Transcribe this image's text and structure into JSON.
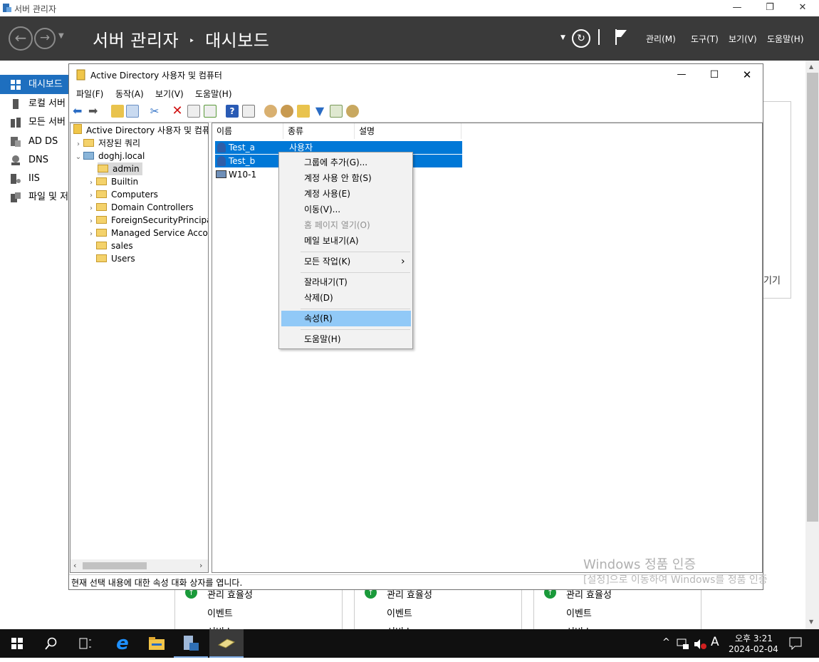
{
  "sm": {
    "app_title": "서버 관리자",
    "breadcrumb_root": "서버 관리자",
    "breadcrumb_sep": "‣",
    "breadcrumb_page": "대시보드",
    "menus": [
      "관리(M)",
      "도구(T)",
      "보기(V)",
      "도움말(H)"
    ],
    "nav": [
      "대시보드",
      "로컬 서버",
      "모든 서버",
      "AD DS",
      "DNS",
      "IIS",
      "파일 및 저장소"
    ],
    "right_text": "기기",
    "tiles": [
      {
        "line1": "관리 효율성",
        "line2": "이벤트",
        "line3": "서비스"
      },
      {
        "line1": "관리 효율성",
        "line2": "이벤트",
        "line3": "서비스"
      },
      {
        "line1": "관리 효율성",
        "line2": "이벤트",
        "line3": "서비스"
      }
    ]
  },
  "aduc": {
    "title": "Active Directory 사용자 및 컴퓨터",
    "menu": [
      "파일(F)",
      "동작(A)",
      "보기(V)",
      "도움말(H)"
    ],
    "tree": {
      "root": "Active Directory 사용자 및 컴퓨터",
      "saved": "저장된 쿼리",
      "domain": "doghj.local",
      "children": [
        "admin",
        "Builtin",
        "Computers",
        "Domain Controllers",
        "ForeignSecurityPrincipals",
        "Managed Service Accounts",
        "sales",
        "Users"
      ]
    },
    "columns": [
      "이름",
      "종류",
      "설명"
    ],
    "rows": [
      {
        "name": "Test_a",
        "type": "사용자",
        "desc": ""
      },
      {
        "name": "Test_b",
        "type": "",
        "desc": ""
      },
      {
        "name": "W10-1",
        "type": "",
        "desc": ""
      }
    ],
    "status": "현재 선택 내용에 대한 속성 대화 상자를 엽니다."
  },
  "context_menu": {
    "items": [
      {
        "label": "그룹에 추가(G)..."
      },
      {
        "label": "계정 사용 안 함(S)"
      },
      {
        "label": "계정 사용(E)"
      },
      {
        "label": "이동(V)..."
      },
      {
        "label": "홈 페이지 열기(O)"
      },
      {
        "label": "메일 보내기(A)"
      },
      {
        "label": "모든 작업(K)"
      },
      {
        "label": "잘라내기(T)"
      },
      {
        "label": "삭제(D)"
      },
      {
        "label": "속성(R)"
      },
      {
        "label": "도움말(H)"
      }
    ],
    "submenu_arrow": "›"
  },
  "watermark": {
    "line1": "Windows 정품 인증",
    "line2": "[설정]으로 이동하여 Windows를 정품 인증"
  },
  "taskbar": {
    "time": "오후 3:21",
    "date": "2024-02-04",
    "ime": "A"
  },
  "colors": {
    "header_bg": "#3a3a3a",
    "nav_selected": "#1e6fbf",
    "row_selected": "#0078d7",
    "menu_highlight": "#91c9f7",
    "taskbar": "#101010"
  }
}
